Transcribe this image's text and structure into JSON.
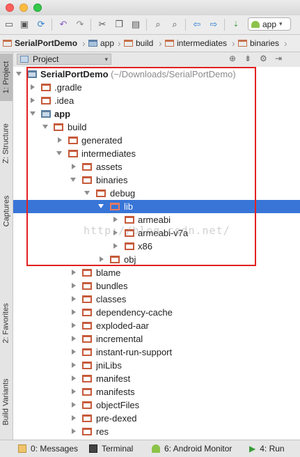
{
  "toolbar": {
    "run_config": "app"
  },
  "breadcrumbs": [
    "SerialPortDemo",
    "app",
    "build",
    "intermediates",
    "binaries"
  ],
  "side_tabs": {
    "project": "1: Project",
    "structure": "Z: Structure",
    "captures": "Captures",
    "favorites": "2: Favorites",
    "build_variants": "Build Variants"
  },
  "panel": {
    "title": "Project"
  },
  "tree": {
    "root_name": "SerialPortDemo",
    "root_path": "(~/Downloads/SerialPortDemo)",
    "items": [
      ".gradle",
      ".idea",
      "app",
      "build",
      "generated",
      "intermediates",
      "assets",
      "binaries",
      "debug",
      "lib",
      "armeabi",
      "armeabi-v7a",
      "x86",
      "obj",
      "blame",
      "bundles",
      "classes",
      "dependency-cache",
      "exploded-aar",
      "incremental",
      "instant-run-support",
      "jniLibs",
      "manifest",
      "manifests",
      "objectFiles",
      "pre-dexed",
      "res"
    ]
  },
  "watermark": "http://blog.csdn.net/",
  "bottom_tabs": {
    "messages": "0: Messages",
    "terminal": "Terminal",
    "android_monitor": "6: Android Monitor",
    "run": "4: Run"
  },
  "colors": {
    "selection": "#3875d7",
    "highlight_box": "#e32020",
    "folder": "#c65a3a"
  }
}
